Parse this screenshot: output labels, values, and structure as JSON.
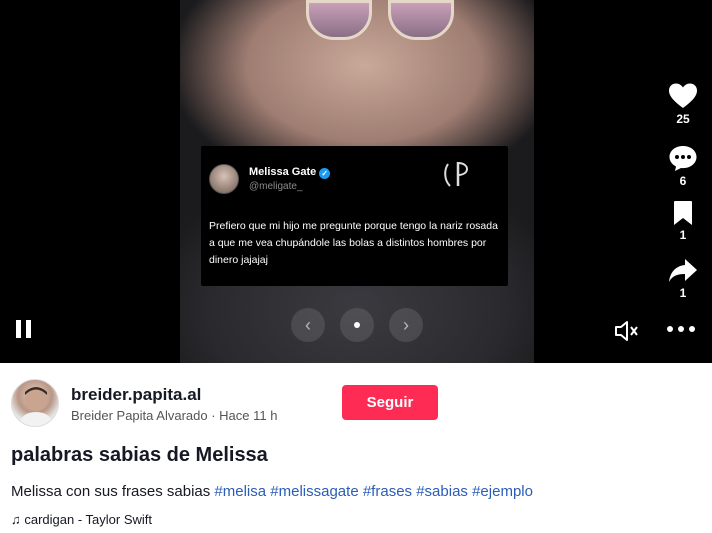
{
  "tweet": {
    "name": "Melissa Gate",
    "handle": "@meligate_",
    "text": "Prefiero que mi hijo me pregunte porque tengo la nariz rosada a que me vea chupándole las bolas a distintos hombres por dinero jajajaj"
  },
  "actions": {
    "likes": "25",
    "comments": "6",
    "saves": "1",
    "shares": "1"
  },
  "author": {
    "username": "breider.papita.al",
    "display_name": "Breider Papita Alvarado",
    "separator": " · ",
    "posted": "Hace 11 h"
  },
  "follow_label": "Seguir",
  "post": {
    "title": "palabras sabias de Melissa",
    "description": "Melissa con sus frases sabias",
    "hashtags": [
      "#melisa",
      "#melissagate",
      "#frases",
      "#sabias",
      "#ejemplo"
    ],
    "music_note": "♫",
    "music": "cardigan - Taylor Swift"
  },
  "icons": {
    "like": "heart-icon",
    "comment": "comment-icon",
    "save": "bookmark-icon",
    "share": "share-icon",
    "pause": "pause-icon",
    "volume": "volume-icon",
    "more": "more-icon"
  },
  "colors": {
    "follow": "#fe2c55",
    "hashtag": "#2b5db8",
    "verified": "#1d9bf0"
  }
}
